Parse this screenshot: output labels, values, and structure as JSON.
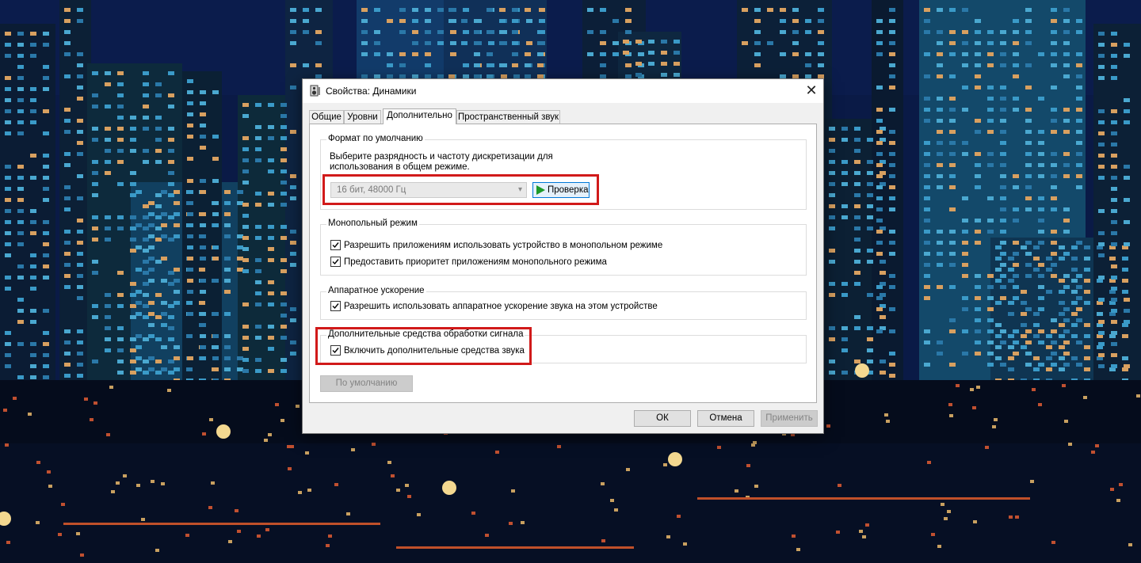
{
  "dialog": {
    "title": "Свойства: Динамики",
    "close_glyph": "✕",
    "tabs": [
      {
        "label": "Общие",
        "active": false
      },
      {
        "label": "Уровни",
        "active": false
      },
      {
        "label": "Дополнительно",
        "active": true
      },
      {
        "label": "Пространственный звук",
        "active": false
      }
    ],
    "default_format": {
      "title": "Формат по умолчанию",
      "description_line1": "Выберите разрядность и частоту дискретизации для",
      "description_line2": "использования в общем режиме.",
      "selected_format": "16 бит, 48000 Гц",
      "test_button": "Проверка"
    },
    "exclusive_mode": {
      "title": "Монопольный режим",
      "options": [
        {
          "label": "Разрешить приложениям использовать устройство в монопольном режиме",
          "checked": true
        },
        {
          "label": "Предоставить приоритет приложениям монопольного режима",
          "checked": true
        }
      ]
    },
    "hardware_acceleration": {
      "title": "Аппаратное ускорение",
      "options": [
        {
          "label": "Разрешить использовать аппаратное ускорение звука на этом устройстве",
          "checked": true
        }
      ]
    },
    "signal_enhancements": {
      "title": "Дополнительные средства обработки сигнала",
      "options": [
        {
          "label": "Включить дополнительные средства звука",
          "checked": true
        }
      ]
    },
    "restore_defaults_button": "По умолчанию",
    "buttons": {
      "ok": "ОК",
      "cancel": "Отмена",
      "apply": "Применить"
    }
  },
  "colors": {
    "highlight": "#d11a1a",
    "focus_border": "#0078d7",
    "play_icon": "#1e9a2a"
  },
  "icons": {
    "title": "speaker-icon",
    "close": "close-icon",
    "test": "play-icon",
    "dropdown": "chevron-down-icon",
    "checkbox": "checkmark-icon"
  }
}
